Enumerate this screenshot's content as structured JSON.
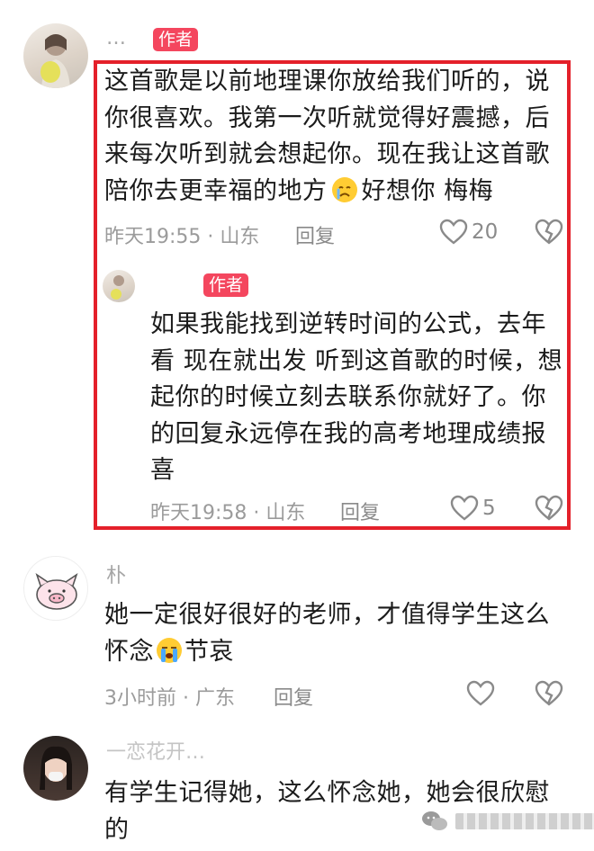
{
  "colors": {
    "author_badge": "#f4465e",
    "highlight_border": "#e4202a",
    "meta_text": "#9b9b9b"
  },
  "comments": [
    {
      "username": "…",
      "badge": "作者",
      "text_lines": [
        "这首歌是以前地理课你放给我们听的，说",
        "你很喜欢。我第一次听就觉得好震撼，后",
        "来每次听到就会想起你。现在我让这首歌"
      ],
      "text_last_a": "陪你去更幸福的地方",
      "text_last_b": "好想你 梅梅",
      "emoji": "sad-face-emoji",
      "meta": "昨天19:55 · 山东",
      "reply": "回复",
      "likes": "20",
      "reply_item": {
        "badge": "作者",
        "text_lines": [
          "如果我能找到逆转时间的公式，去年",
          "看 现在就出发 听到这首歌的时候，想",
          "起你的时候立刻去联系你就好了。你",
          "的回复永远停在我的高考地理成绩报",
          "喜"
        ],
        "meta": "昨天19:58 · 山东",
        "reply": "回复",
        "likes": "5"
      }
    },
    {
      "username": "朴",
      "text_line1": "她一定很好很好的老师，才值得学生这么",
      "text_line2_a": "怀念",
      "text_line2_b": "节哀",
      "emoji": "crying-face-emoji",
      "meta": "3小时前 · 广东",
      "reply": "回复"
    },
    {
      "username": "一恋花开…",
      "text_lines": [
        "有学生记得她，这么怀念她，她会很欣慰",
        "的"
      ]
    }
  ],
  "icons": [
    "heart-icon",
    "broken-heart-icon",
    "wechat-icon"
  ]
}
